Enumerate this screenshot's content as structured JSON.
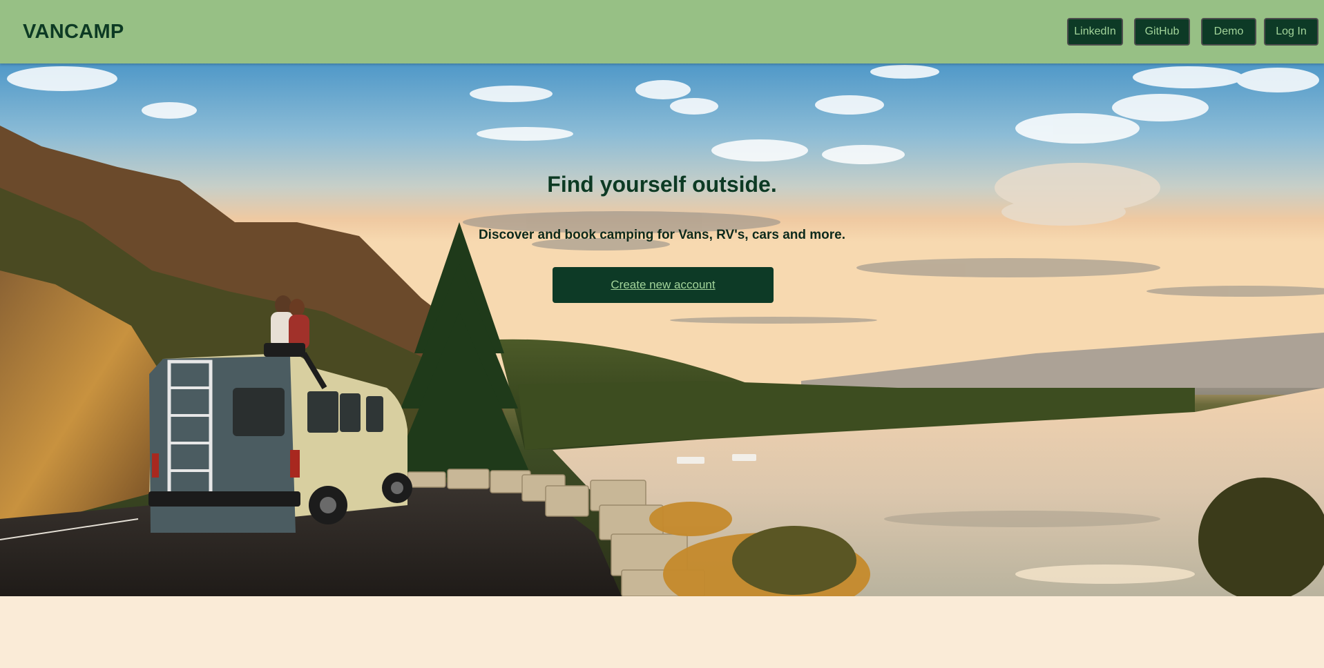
{
  "header": {
    "logo": "VANCAMP",
    "nav": {
      "linkedin": "LinkedIn",
      "github": "GitHub",
      "demo": "Demo",
      "login": "Log In"
    }
  },
  "hero": {
    "title": "Find yourself outside.",
    "subtitle": "Discover and book camping for Vans, RV's, cars and more.",
    "cta_label": "Create new account",
    "image_description": "van parked on mountain road beside lake at sunset"
  },
  "colors": {
    "header_bg": "#97c085",
    "button_bg": "#0d3a26",
    "button_text": "#a2d49a",
    "title_text": "#0d3a24",
    "page_bg": "#faebd7"
  }
}
